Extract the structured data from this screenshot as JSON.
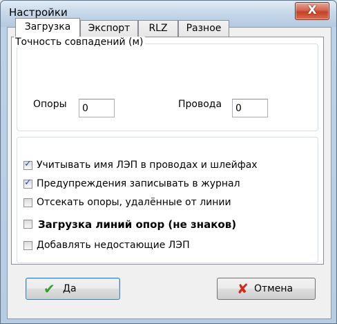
{
  "window": {
    "title": "Настройки",
    "close_glyph": "X"
  },
  "tabs": [
    {
      "label": "Загрузка",
      "active": true
    },
    {
      "label": "Экспорт",
      "active": false
    },
    {
      "label": "RLZ",
      "active": false
    },
    {
      "label": "Разное",
      "active": false
    }
  ],
  "accuracy": {
    "title": "Точность совпадений (м)",
    "supports_label": "Опоры",
    "supports_value": "0",
    "wires_label": "Провода",
    "wires_value": "0"
  },
  "options": [
    {
      "label": "Учитывать имя ЛЭП в проводах и шлейфах",
      "checked": true
    },
    {
      "label": "Предупреждения записывать в журнал",
      "checked": true
    },
    {
      "label": "Отсекать опоры, удалённые от линии",
      "checked": false
    },
    {
      "label": "Загрузка линий опор (не знаков)",
      "checked": false
    },
    {
      "label": "Добавлять недостающие ЛЭП",
      "checked": false
    }
  ],
  "buttons": {
    "ok_label": "Да",
    "cancel_label": "Отмена"
  },
  "colors": {
    "ok_icon": "#2fa12b",
    "cancel_icon": "#d12a1c",
    "check": "#2a4bb0"
  }
}
